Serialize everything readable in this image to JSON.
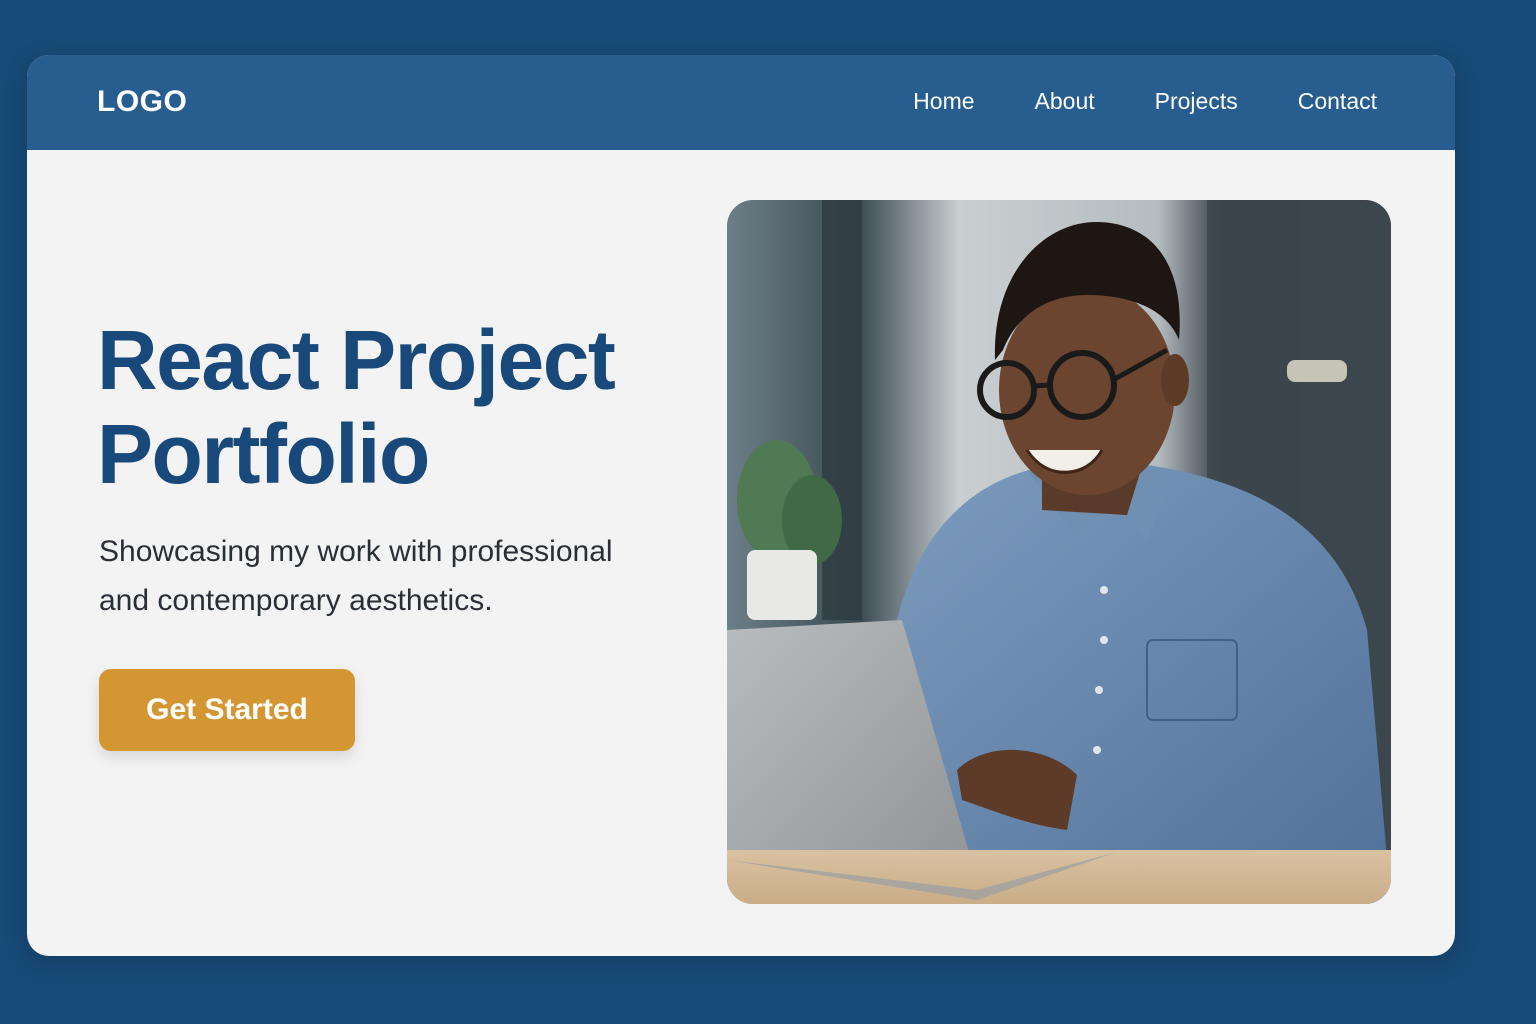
{
  "header": {
    "logo": "LOGO",
    "nav": [
      {
        "label": "Home"
      },
      {
        "label": "About"
      },
      {
        "label": "Projects"
      },
      {
        "label": "Contact"
      }
    ]
  },
  "hero": {
    "title_line1": "React Project",
    "title_line2": "Portfolio",
    "subtitle_line1": "Showcasing my work with professional",
    "subtitle_line2": "and contemporary aesthetics.",
    "cta_label": "Get Started",
    "image_alt": "Smiling man with glasses working on a laptop"
  },
  "colors": {
    "background": "#174a77",
    "navbar": "#285d8f",
    "title": "#19487a",
    "cta": "#d49632",
    "card": "#f3f3f3"
  }
}
